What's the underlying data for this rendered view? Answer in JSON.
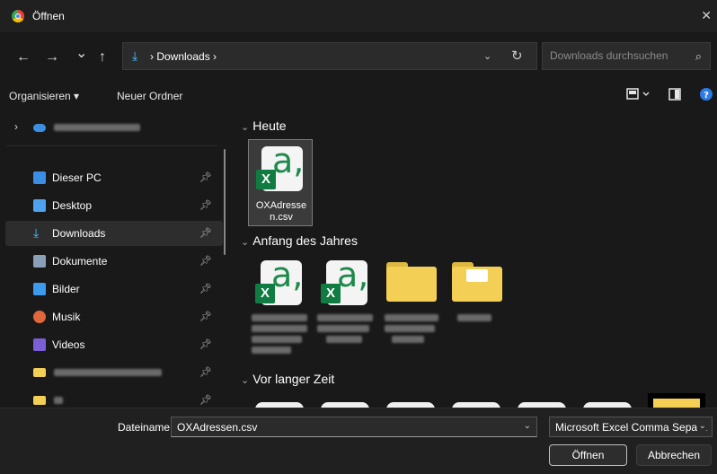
{
  "window": {
    "title": "Öffnen",
    "close_icon": "close-icon"
  },
  "nav": {
    "back_icon": "←",
    "forward_icon": "→",
    "recent_icon": "⌄",
    "up_icon": "↑",
    "address_path": "› Downloads ›",
    "refresh_icon": "↻",
    "search_placeholder": "Downloads durchsuchen"
  },
  "toolbar": {
    "organize_label": "Organisieren ▾",
    "new_folder_label": "Neuer Ordner"
  },
  "sidebar": {
    "items": [
      {
        "label": "Dieser PC",
        "icon_color": "#3a8ee6"
      },
      {
        "label": "Desktop",
        "icon_color": "#4da3f0"
      },
      {
        "label": "Downloads",
        "icon_color": "#4cc2ff"
      },
      {
        "label": "Dokumente",
        "icon_color": "#8aa0b8"
      },
      {
        "label": "Bilder",
        "icon_color": "#3a9bef"
      },
      {
        "label": "Musik",
        "icon_color": "#e0663c"
      },
      {
        "label": "Videos",
        "icon_color": "#7b5fd6"
      }
    ]
  },
  "content": {
    "groups": [
      {
        "header": "Heute"
      },
      {
        "header": "Anfang des Jahres"
      },
      {
        "header": "Vor langer Zeit"
      }
    ],
    "selected_file": "OXAdressen.csv",
    "selected_file_wrapped_1": "OXAdresse",
    "selected_file_wrapped_2": "n.csv"
  },
  "bottom": {
    "filename_label": "Dateiname:",
    "filename_value": "OXAdressen.csv",
    "filetype_value": "Microsoft Excel Comma Separa",
    "open_label": "Öffnen",
    "cancel_label": "Abbrechen"
  },
  "colors": {
    "accent": "#4cc2ff",
    "excel_green": "#107c41",
    "folder": "#f4cf55",
    "help": "#2d7be5"
  }
}
